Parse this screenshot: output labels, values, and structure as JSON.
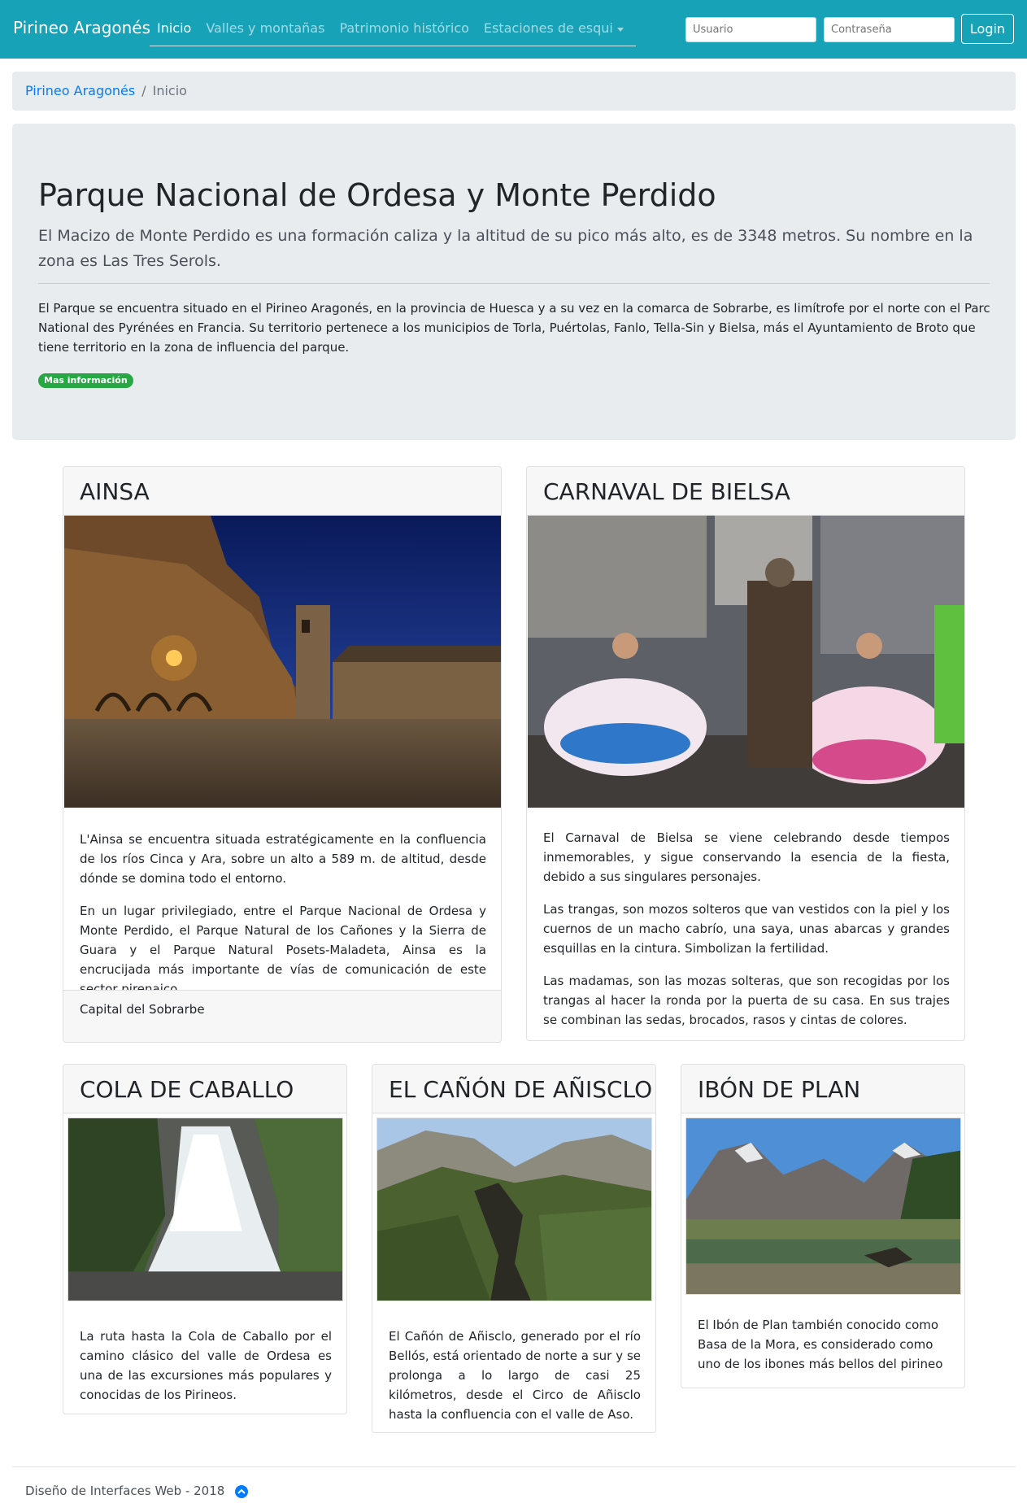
{
  "nav": {
    "brand": "Pirineo Aragonés",
    "links": [
      "Inicio",
      "Valles y montañas",
      "Patrimonio histórico",
      "Estaciones de esqui"
    ],
    "user_placeholder": "Usuario",
    "pass_placeholder": "Contraseña",
    "login_label": "Login"
  },
  "breadcrumb": {
    "home": "Pirineo Aragonés",
    "separator": "/",
    "current": "Inicio"
  },
  "hero": {
    "title": "Parque Nacional de Ordesa y Monte Perdido",
    "lead": "El Macizo de Monte Perdido es una formación caliza y la altitud de su pico más alto, es de 3348 metros. Su nombre en la zona es Las Tres Serols.",
    "text": "El Parque se encuentra situado en el Pirineo Aragonés, en la provincia de Huesca y a su vez en la comarca de Sobrarbe, es limítrofe por el norte con el Parc National des Pyrénées en Francia. Su territorio pertenece a los municipios de Torla, Puértolas, Fanlo, Tella-Sin y Bielsa, más el Ayuntamiento de Broto que tiene territorio en la zona de influencia del parque.",
    "badge": "Mas información"
  },
  "cards": {
    "ainsa": {
      "title": "AINSA",
      "p1": "L'Ainsa se encuentra situada estratégicamente en la confluencia de los ríos Cinca y Ara, sobre un alto a 589 m. de altitud, desde dónde se domina todo el entorno.",
      "p2": "En un lugar privilegiado, entre el Parque Nacional de Ordesa y Monte Perdido, el Parque Natural de los Cañones y la Sierra de Guara y el Parque Natural Posets-Maladeta, Ainsa es la encrucijada más importante de vías de comunicación de este sector pirenaico.",
      "footer": "Capital del Sobrarbe"
    },
    "bielsa": {
      "title": "CARNAVAL DE BIELSA",
      "p1": "El Carnaval de Bielsa se viene celebrando desde tiempos inmemorables, y sigue conservando la esencia de la fiesta, debido a sus singulares personajes.",
      "p2": "Las trangas, son mozos solteros que van vestidos con la piel y los cuernos de un macho cabrío, una saya, unas abarcas y grandes esquillas en la cintura. Simbolizan la fertilidad.",
      "p3": "Las madamas, son las mozas solteras, que son recogidas por los trangas al hacer la ronda por la puerta de su casa. En sus trajes se combinan las sedas, brocados, rasos y cintas de colores."
    },
    "cola": {
      "title": "COLA DE CABALLO",
      "p1": "La ruta hasta la Cola de Caballo por el camino clásico del valle de Ordesa es una de las excursiones más populares y conocidas de los Pirineos."
    },
    "aniscle": {
      "title": "EL CAÑÓN DE AÑISCLO",
      "p1": "El Cañón de Añisclo, generado por el río Bellós, está orientado de norte a sur y se prolonga a lo largo de casi 25 kilómetros, desde el Circo de Añisclo hasta la confluencia con el valle de Aso."
    },
    "plan": {
      "title": "IBÓN DE PLAN",
      "p1": "El Ibón de Plan también conocido como Basa de la Mora, es considerado como uno de los ibones más bellos del pirineo"
    }
  },
  "footer": {
    "text": "Diseño de Interfaces Web - 2018"
  },
  "colors": {
    "navbar": "#17a2b8",
    "link": "#007bff",
    "badge": "#28a745"
  }
}
